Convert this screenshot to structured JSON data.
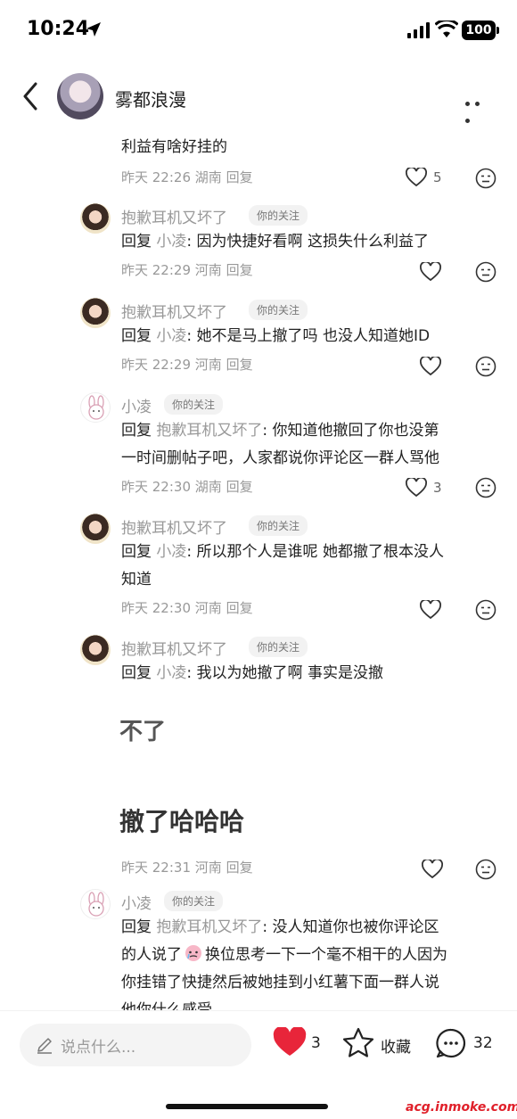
{
  "status": {
    "time": "10:24",
    "battery": "100"
  },
  "header": {
    "name": "雾都浪漫"
  },
  "comments": [
    {
      "text": "利益有啥好挂的",
      "time": "昨天 22:26",
      "region": "湖南",
      "reply": "回复",
      "likes": "5"
    },
    {
      "author": "抱歉耳机又坏了",
      "tag": "你的关注",
      "reply_word": "回复",
      "reply_to": "小凌",
      "text": ": 因为快捷好看啊 这损失什么利益了",
      "time": "昨天 22:29",
      "region": "河南",
      "reply": "回复"
    },
    {
      "author": "抱歉耳机又坏了",
      "tag": "你的关注",
      "reply_word": "回复",
      "reply_to": "小凌",
      "text": ": 她不是马上撤了吗 也没人知道她ID",
      "time": "昨天 22:29",
      "region": "河南",
      "reply": "回复"
    },
    {
      "author": "小凌",
      "tag": "你的关注",
      "reply_word": "回复",
      "reply_to": "抱歉耳机又坏了",
      "text": ": 你知道他撤回了你也没第",
      "text2": "一时间删帖子吧，人家都说你评论区一群人骂他",
      "time": "昨天 22:30",
      "region": "湖南",
      "reply": "回复",
      "likes": "3"
    },
    {
      "author": "抱歉耳机又坏了",
      "tag": "你的关注",
      "reply_word": "回复",
      "reply_to": "小凌",
      "text": ": 所以那个人是谁呢 她都撤了根本没人",
      "text2": "知道",
      "time": "昨天 22:30",
      "region": "河南",
      "reply": "回复"
    },
    {
      "author": "抱歉耳机又坏了",
      "tag": "你的关注",
      "reply_word": "回复",
      "reply_to": "小凌",
      "text": ": 我以为她撤了啊 事实是没撤"
    },
    {
      "partial1": "不了",
      "partial2": "撤了哈哈哈",
      "time": "昨天 22:31",
      "region": "河南",
      "reply": "回复"
    },
    {
      "author": "小凌",
      "tag": "你的关注",
      "reply_word": "回复",
      "reply_to": "抱歉耳机又坏了",
      "text": ": 没人知道你也被你评论区",
      "text2": "的人说了",
      "text3": "换位思考一下一个毫不相干的人因为",
      "text4": "你挂错了快捷然后被她挂到小红薯下面一群人说",
      "text5": "他你什么感受"
    }
  ],
  "bottom": {
    "placeholder": "说点什么...",
    "likes": "3",
    "fav_label": "收藏",
    "comments": "32"
  },
  "watermark": "acg.inmoke.com",
  "colors": {
    "accent": "#e8253a",
    "muted": "#999999"
  }
}
